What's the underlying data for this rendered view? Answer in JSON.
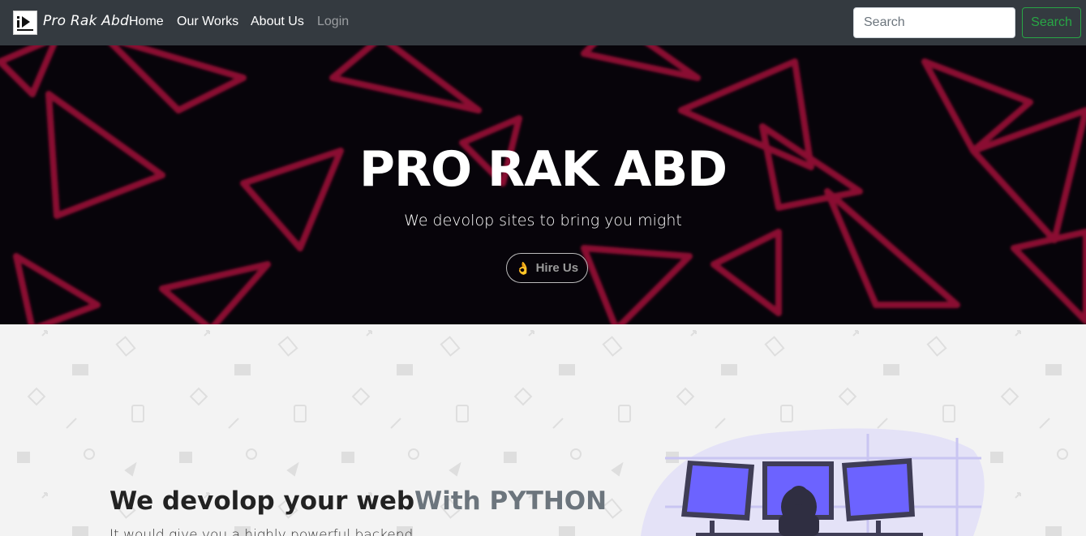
{
  "nav": {
    "brand": "Pro Rak Abd",
    "links": [
      {
        "label": "Home"
      },
      {
        "label": "Our Works"
      },
      {
        "label": "About Us"
      },
      {
        "label": "Login",
        "muted": true
      }
    ],
    "search_placeholder": "Search",
    "search_button": "Search"
  },
  "hero": {
    "title": "PRO RAK ABD",
    "subtitle": "We devolop sites to bring you might",
    "hire_label": "Hire Us",
    "hire_icon": "ok-hand-icon"
  },
  "section": {
    "title_main": "We devolop your web",
    "title_highlight": "With PYTHON",
    "description": "It would give you a highly powerful backend"
  },
  "colors": {
    "navbar": "#343a40",
    "accent_green": "#28a745",
    "hero_bg": "#07040a",
    "hero_triangles": "#8a1030",
    "illustration_purple": "#6c63ff"
  }
}
